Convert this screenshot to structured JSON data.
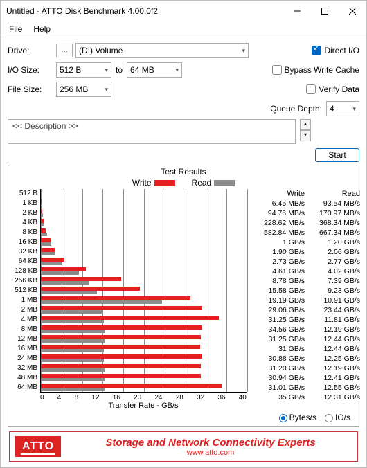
{
  "window": {
    "title": "Untitled - ATTO Disk Benchmark 4.00.0f2"
  },
  "menu": {
    "file": "File",
    "help": "Help"
  },
  "form": {
    "drive_label": "Drive:",
    "drive_dots": "...",
    "drive_value": "(D:) Volume",
    "io_label": "I/O Size:",
    "io_from": "512 B",
    "io_to_label": "to",
    "io_to": "64 MB",
    "fs_label": "File Size:",
    "fs_value": "256 MB",
    "direct_io": "Direct I/O",
    "bypass": "Bypass Write Cache",
    "verify": "Verify Data",
    "qd_label": "Queue Depth:",
    "qd_value": "4",
    "desc": "<< Description >>",
    "start": "Start"
  },
  "results_header": {
    "title": "Test Results",
    "write": "Write",
    "read": "Read",
    "xtitle": "Transfer Rate  -  GB/s",
    "bytes_s": "Bytes/s",
    "io_s": "IO/s"
  },
  "colors": {
    "write": "#e62020",
    "read": "#8c8c8c"
  },
  "chart_data": {
    "type": "bar",
    "x_max": 40,
    "x_ticks": [
      0,
      4,
      8,
      12,
      16,
      20,
      24,
      28,
      32,
      36,
      40
    ],
    "rows": [
      {
        "label": "512 B",
        "write_gb": 0.006,
        "read_gb": 0.094,
        "write_txt": "6.45 MB/s",
        "read_txt": "93.54 MB/s"
      },
      {
        "label": "1 KB",
        "write_gb": 0.095,
        "read_gb": 0.171,
        "write_txt": "94.76 MB/s",
        "read_txt": "170.97 MB/s"
      },
      {
        "label": "2 KB",
        "write_gb": 0.229,
        "read_gb": 0.368,
        "write_txt": "228.62 MB/s",
        "read_txt": "368.34 MB/s"
      },
      {
        "label": "4 KB",
        "write_gb": 0.583,
        "read_gb": 0.667,
        "write_txt": "582.84 MB/s",
        "read_txt": "667.34 MB/s"
      },
      {
        "label": "8 KB",
        "write_gb": 1.0,
        "read_gb": 1.2,
        "write_txt": "1 GB/s",
        "read_txt": "1.20 GB/s"
      },
      {
        "label": "16 KB",
        "write_gb": 1.9,
        "read_gb": 2.06,
        "write_txt": "1.90 GB/s",
        "read_txt": "2.06 GB/s"
      },
      {
        "label": "32 KB",
        "write_gb": 2.73,
        "read_gb": 2.77,
        "write_txt": "2.73 GB/s",
        "read_txt": "2.77 GB/s"
      },
      {
        "label": "64 KB",
        "write_gb": 4.61,
        "read_gb": 4.02,
        "write_txt": "4.61 GB/s",
        "read_txt": "4.02 GB/s"
      },
      {
        "label": "128 KB",
        "write_gb": 8.78,
        "read_gb": 7.39,
        "write_txt": "8.78 GB/s",
        "read_txt": "7.39 GB/s"
      },
      {
        "label": "256 KB",
        "write_gb": 15.58,
        "read_gb": 9.23,
        "write_txt": "15.58 GB/s",
        "read_txt": "9.23 GB/s"
      },
      {
        "label": "512 KB",
        "write_gb": 19.19,
        "read_gb": 10.91,
        "write_txt": "19.19 GB/s",
        "read_txt": "10.91 GB/s"
      },
      {
        "label": "1 MB",
        "write_gb": 29.06,
        "read_gb": 23.44,
        "write_txt": "29.06 GB/s",
        "read_txt": "23.44 GB/s"
      },
      {
        "label": "2 MB",
        "write_gb": 31.25,
        "read_gb": 11.81,
        "write_txt": "31.25 GB/s",
        "read_txt": "11.81 GB/s"
      },
      {
        "label": "4 MB",
        "write_gb": 34.56,
        "read_gb": 12.19,
        "write_txt": "34.56 GB/s",
        "read_txt": "12.19 GB/s"
      },
      {
        "label": "8 MB",
        "write_gb": 31.25,
        "read_gb": 12.44,
        "write_txt": "31.25 GB/s",
        "read_txt": "12.44 GB/s"
      },
      {
        "label": "12 MB",
        "write_gb": 31.0,
        "read_gb": 12.44,
        "write_txt": "31 GB/s",
        "read_txt": "12.44 GB/s"
      },
      {
        "label": "16 MB",
        "write_gb": 30.88,
        "read_gb": 12.25,
        "write_txt": "30.88 GB/s",
        "read_txt": "12.25 GB/s"
      },
      {
        "label": "24 MB",
        "write_gb": 31.2,
        "read_gb": 12.19,
        "write_txt": "31.20 GB/s",
        "read_txt": "12.19 GB/s"
      },
      {
        "label": "32 MB",
        "write_gb": 30.94,
        "read_gb": 12.41,
        "write_txt": "30.94 GB/s",
        "read_txt": "12.41 GB/s"
      },
      {
        "label": "48 MB",
        "write_gb": 31.01,
        "read_gb": 12.55,
        "write_txt": "31.01 GB/s",
        "read_txt": "12.55 GB/s"
      },
      {
        "label": "64 MB",
        "write_gb": 35.0,
        "read_gb": 12.31,
        "write_txt": "35 GB/s",
        "read_txt": "12.31 GB/s"
      }
    ]
  },
  "footer": {
    "logo": "ATTO",
    "line1": "Storage and Network Connectivity Experts",
    "line2": "www.atto.com"
  }
}
